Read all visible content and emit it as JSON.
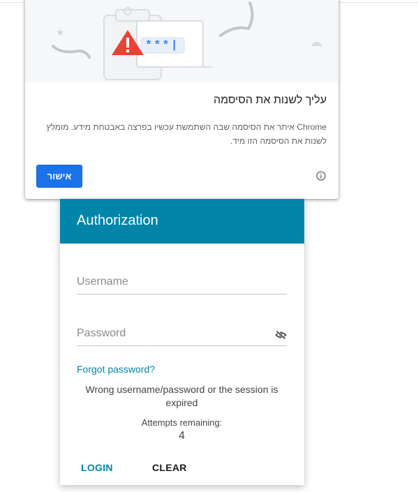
{
  "bubble": {
    "title": "עליך לשנות את הסיסמה",
    "body": "Chrome איתר את הסיסמה שבה השתמשת עכשיו בפרצה באבטחת מידע. מומלץ לשנות את הסיסמה הזו מיד.",
    "confirm_label": "אישור",
    "illustration_mask": "***|",
    "icons": [
      "warning-icon",
      "info-icon"
    ],
    "colors": {
      "confirm": "#1a73e8",
      "warning": "#ea4335",
      "mask": "#4285f4"
    }
  },
  "auth": {
    "title": "Authorization",
    "username_placeholder": "Username",
    "password_placeholder": "Password",
    "forgot_label": "Forgot password?",
    "error_message": "Wrong username/password or the session is expired",
    "attempts_label": "Attempts remaining:",
    "attempts_count": "4",
    "login_label": "LOGIN",
    "clear_label": "CLEAR",
    "icons": [
      "eye-off-icon"
    ],
    "colors": {
      "header": "#0085a8",
      "accent": "#0085a8"
    }
  }
}
